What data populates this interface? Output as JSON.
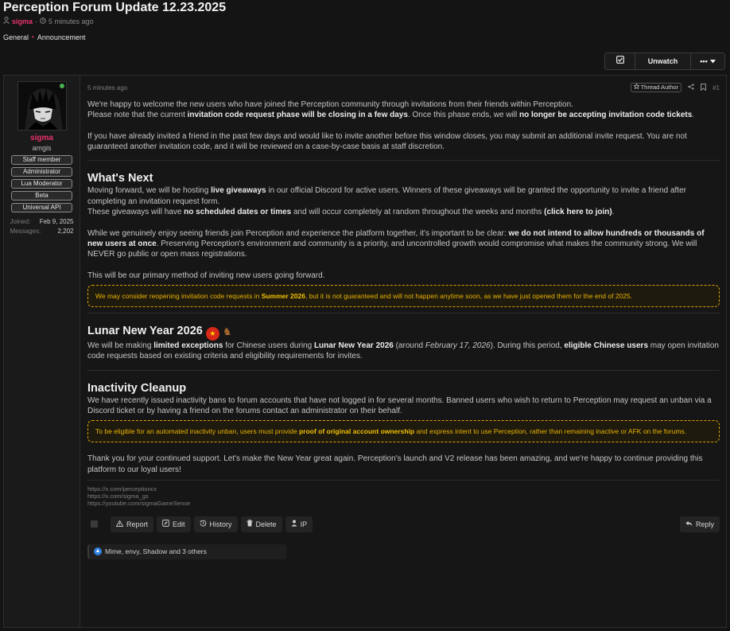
{
  "thread": {
    "title": "Perception Forum Update 12.23.2025",
    "author": "sigma",
    "time_ago": "5 minutes ago",
    "dot": "·",
    "breadcrumbs": [
      "General",
      "Announcement"
    ],
    "breadcrumb_sep": "•"
  },
  "watch_bar": {
    "unwatch_label": "Unwatch",
    "more_label": "•••"
  },
  "user": {
    "name": "sigma",
    "title": "amgis",
    "banners": [
      "Staff member",
      "Administrator",
      "Lua Moderator",
      "Beta",
      "Universal API"
    ],
    "stats": [
      {
        "k": "Joined:",
        "v": "Feb 9, 2025"
      },
      {
        "k": "Messages:",
        "v": "2,202"
      }
    ]
  },
  "post": {
    "time_ago": "5 minutes ago",
    "thread_author_label": "Thread Author",
    "number": "#1",
    "p1a": "We're happy to welcome the new users who have joined the Perception community through invitations from their friends within Perception.",
    "p1b_1": "Please note that the current ",
    "p1b_2": "invitation code request phase will be closing in a few days",
    "p1b_3": ". Once this phase ends, we will ",
    "p1b_4": "no longer be accepting invitation code tickets",
    "p1b_5": ".",
    "p2": "If you have already invited a friend in the past few days and would like to invite another before this window closes, you may submit an additional invite request. You are not guaranteed another invitation code, and it will be reviewed on a case-by-case basis at staff discretion.",
    "h_next": "What's Next",
    "n1_1": "Moving forward, we will be hosting ",
    "n1_2": "live giveaways",
    "n1_3": " in our official Discord for active users. Winners of these giveaways will be granted the opportunity to invite a friend after completing an invitation request form.",
    "n2_1": "These giveaways will have ",
    "n2_2": "no scheduled dates or times",
    "n2_3": " and will occur completely at random throughout the weeks and months ",
    "n2_4": "(click here to join)",
    "n2_5": ".",
    "n3_1": "While we genuinely enjoy seeing friends join Perception and experience the platform together, it's important to be clear: ",
    "n3_2": "we do not intend to allow hundreds or thousands of new users at once",
    "n3_3": ". Preserving Perception's environment and community is a priority, and uncontrolled growth would compromise what makes the community strong. We will NEVER go public or open mass registrations.",
    "n4": "This will be our primary method of inviting new users going forward.",
    "notice1_1": "We may consider reopening invitation code requests in ",
    "notice1_2": "Summer 2026",
    "notice1_3": ", but it is not guaranteed and will not happen anytime soon, as we have just opened them for the end of 2025.",
    "h_lunar": "Lunar New Year 2026",
    "l1_1": "We will be making ",
    "l1_2": "limited exceptions",
    "l1_3": " for Chinese users during ",
    "l1_4": "Lunar New Year 2026",
    "l1_5": " (around ",
    "l1_6": "February 17, 2026",
    "l1_7": "). During this period, ",
    "l1_8": "eligible Chinese users",
    "l1_9": " may open invitation code requests based on existing criteria and eligibility requirements for invites.",
    "h_inactivity": "Inactivity Cleanup",
    "i1": "We have recently issued inactivity bans to forum accounts that have not logged in for several months. Banned users who wish to return to Perception may request an unban via a Discord ticket or by having a friend on the forums contact an administrator on their behalf.",
    "notice2_1": "To be eligible for an automated inactivity unban, users must provide ",
    "notice2_2": "proof of original account ownership",
    "notice2_3": " and express intent to use Perception, rather than remaining inactive or AFK on the forums.",
    "closing": "Thank you for your continued support. Let's make the New Year great again. Perception's launch and V2 release has been amazing, and we're happy to continue providing this platform to our loyal users!",
    "signature": [
      "https://x.com/perceptioncx",
      "https://x.com/sigma_gs",
      "https://youtube.com/sigmaGameSense"
    ]
  },
  "actions": {
    "report": "Report",
    "edit": "Edit",
    "history": "History",
    "delete": "Delete",
    "ip": "IP",
    "reply": "Reply"
  },
  "reactions": {
    "text": "Mime, envy, Shadow and 3 others"
  },
  "colors": {
    "accent": "#e8336b",
    "notice": "#e8b400",
    "online": "#4caf50"
  }
}
